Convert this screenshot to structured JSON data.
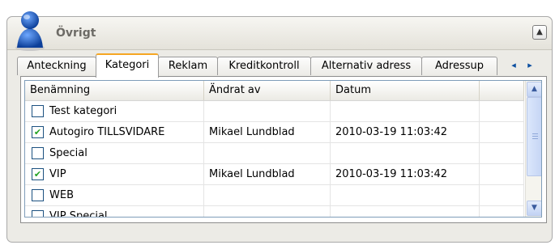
{
  "panel": {
    "title": "Övrigt",
    "collapse_icon": "▲"
  },
  "tabs": [
    {
      "label": "Anteckning"
    },
    {
      "label": "Kategori"
    },
    {
      "label": "Reklam"
    },
    {
      "label": "Kreditkontroll"
    },
    {
      "label": "Alternativ adress"
    },
    {
      "label": "Adressup"
    }
  ],
  "tab_scroll": {
    "left": "◂",
    "right": "▸"
  },
  "grid": {
    "columns": [
      "Benämning",
      "Ändrat av",
      "Datum"
    ],
    "rows": [
      {
        "checked": false,
        "name": "Test kategori",
        "changed_by": "",
        "date": ""
      },
      {
        "checked": true,
        "name": "Autogiro TILLSVIDARE",
        "changed_by": "Mikael Lundblad",
        "date": "2010-03-19 11:03:42"
      },
      {
        "checked": false,
        "name": "Special",
        "changed_by": "",
        "date": ""
      },
      {
        "checked": true,
        "name": "VIP",
        "changed_by": "Mikael Lundblad",
        "date": "2010-03-19 11:03:42"
      },
      {
        "checked": false,
        "name": "WEB",
        "changed_by": "",
        "date": ""
      },
      {
        "checked": false,
        "name": "VIP Special",
        "changed_by": "",
        "date": ""
      }
    ],
    "check_glyph": "✔",
    "scroll_up": "▲",
    "scroll_down": "▼"
  },
  "colors": {
    "active_tab_accent": "#f5a623",
    "avatar_blue": "#1f62c9",
    "check_green": "#21a121"
  }
}
